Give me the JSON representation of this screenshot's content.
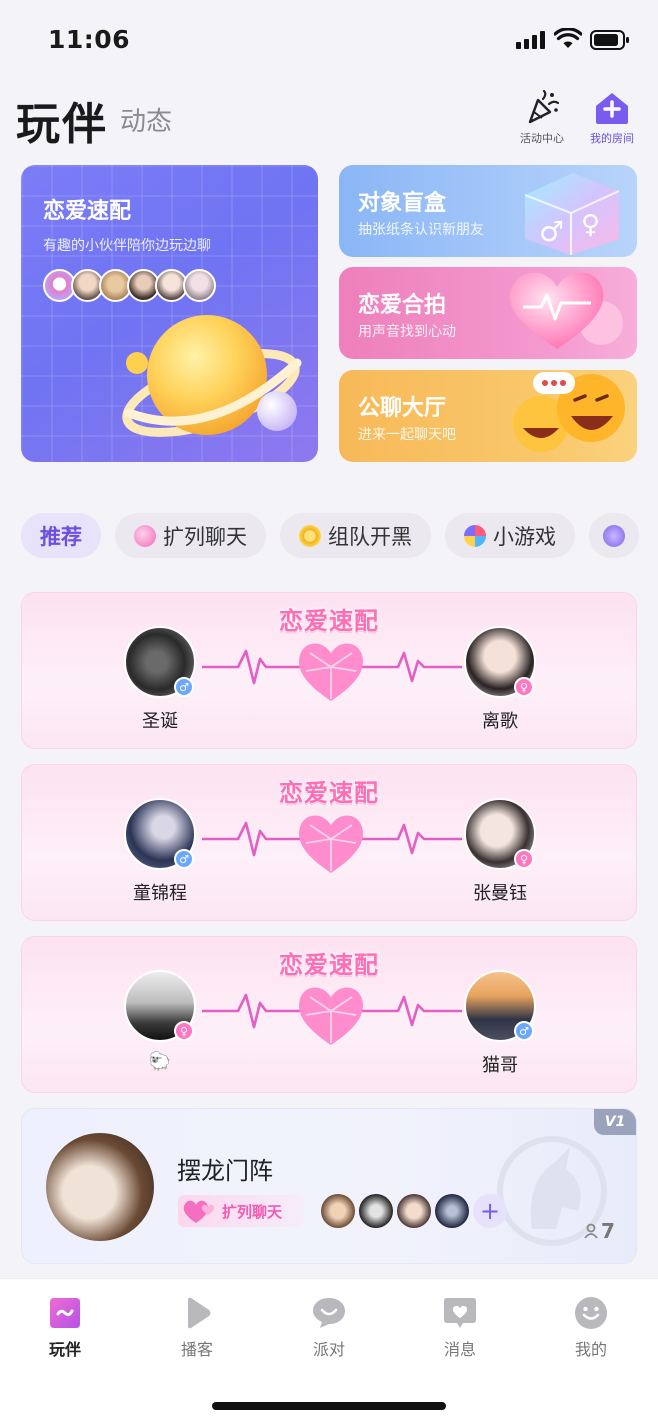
{
  "status_bar": {
    "time": "11:06"
  },
  "header": {
    "title": "玩伴",
    "subtitle": "动态",
    "activity_label": "活动中心",
    "room_label": "我的房间"
  },
  "feature_cards": {
    "speed_match": {
      "title": "恋爱速配",
      "subtitle": "有趣的小伙伴陪你边玩边聊"
    },
    "blind_box": {
      "title": "对象盲盒",
      "subtitle": "抽张纸条认识新朋友"
    },
    "duet": {
      "title": "恋爱合拍",
      "subtitle": "用声音找到心动"
    },
    "public_chat": {
      "title": "公聊大厅",
      "subtitle": "进来一起聊天吧"
    }
  },
  "tabs": [
    {
      "label": "推荐",
      "active": true
    },
    {
      "label": "扩列聊天",
      "icon": "hearts-icon"
    },
    {
      "label": "组队开黑",
      "icon": "coin-icon"
    },
    {
      "label": "小游戏",
      "icon": "game-icon"
    }
  ],
  "matches": [
    {
      "title": "恋爱速配",
      "left_name": "圣诞",
      "left_gender": "♂",
      "right_name": "离歌",
      "right_gender": "♀"
    },
    {
      "title": "恋爱速配",
      "left_name": "童锦程",
      "left_gender": "♂",
      "right_name": "张曼钰",
      "right_gender": "♀"
    },
    {
      "title": "恋爱速配",
      "left_name": "🐑",
      "left_gender": "♀",
      "right_name": "猫哥",
      "right_gender": "♂"
    }
  ],
  "room": {
    "badge": "V1",
    "name": "摆龙门阵",
    "tag": "扩列聊天",
    "count": "7",
    "add": "+"
  },
  "nav": [
    {
      "label": "玩伴",
      "icon": "gamepad-icon",
      "active": true
    },
    {
      "label": "播客",
      "icon": "play-icon"
    },
    {
      "label": "派对",
      "icon": "chat-bubble-icon"
    },
    {
      "label": "消息",
      "icon": "message-heart-icon"
    },
    {
      "label": "我的",
      "icon": "face-icon"
    }
  ],
  "colors": {
    "accent": "#6a4fe0",
    "pink": "#ff6eb5"
  }
}
